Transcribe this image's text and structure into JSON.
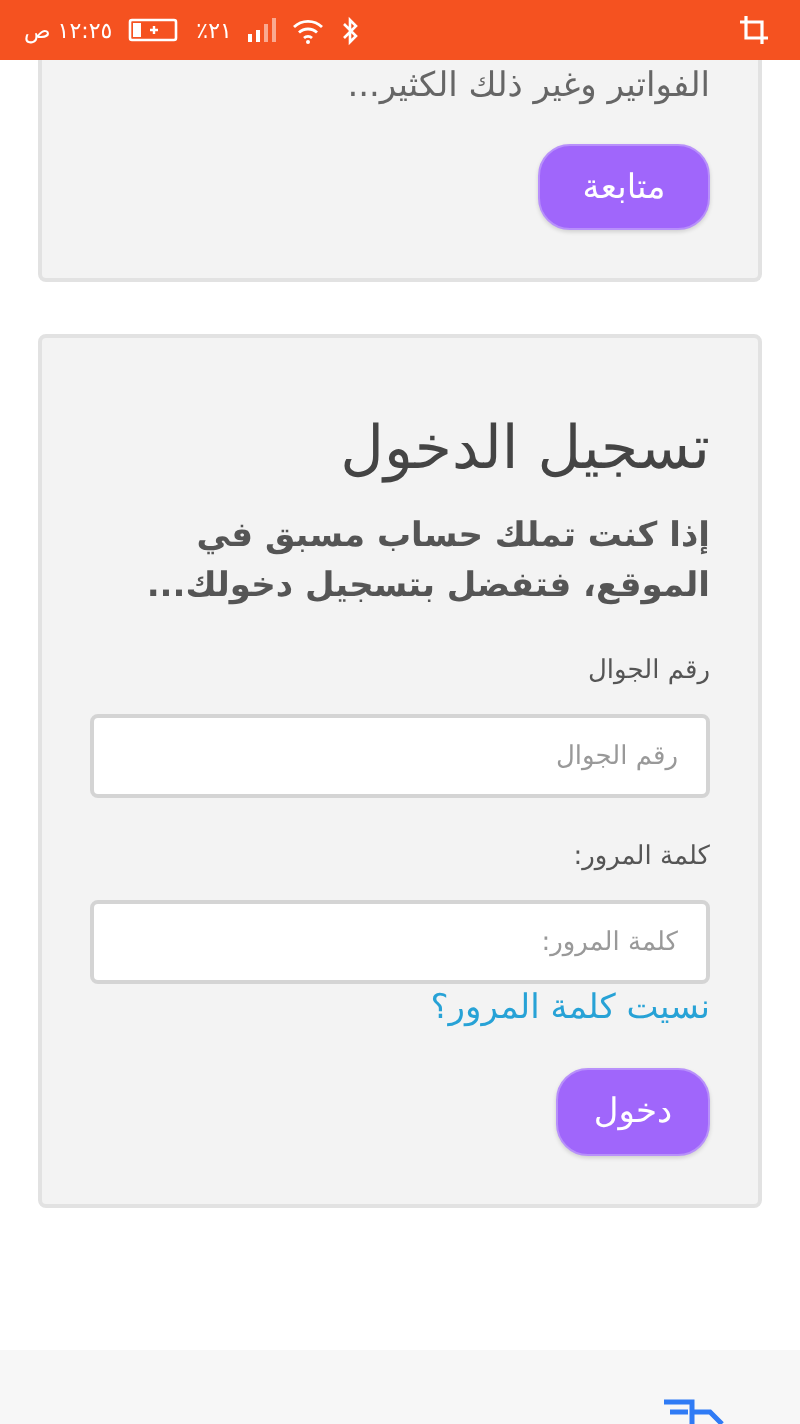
{
  "status_bar": {
    "time": "١٢:٢٥ ص",
    "battery_percent": "٪٢١"
  },
  "intro_card": {
    "text": "الفواتير وغير ذلك الكثير...",
    "button": "متابعة"
  },
  "login_card": {
    "title": "تسجيل الدخول",
    "subtitle": "إذا كنت تملك حساب مسبق في الموقع، فتفضل بتسجيل دخولك...",
    "fields": [
      {
        "label": "رقم الجوال",
        "placeholder": "رقم الجوال"
      },
      {
        "label": "كلمة المرور:",
        "placeholder": "كلمة المرور:"
      }
    ],
    "forgot_link": "نسيت كلمة المرور؟",
    "button": "دخول"
  }
}
